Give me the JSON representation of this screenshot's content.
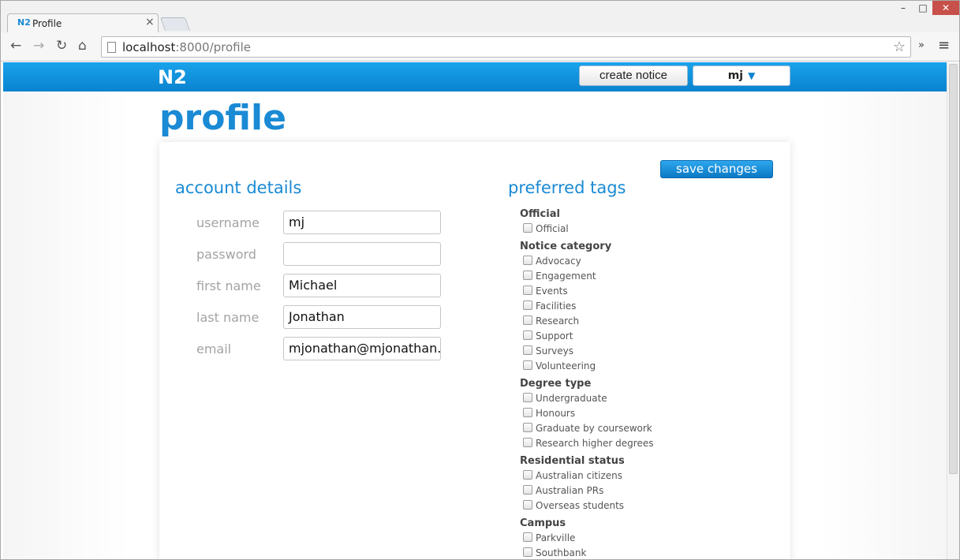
{
  "browser": {
    "tab_favicon": "N2",
    "tab_title": "Profile",
    "tab_close": "×",
    "url_host": "localhost",
    "url_path": ":8000/profile",
    "icons": [
      "back-arrow-icon",
      "forward-arrow-icon",
      "reload-icon",
      "home-icon",
      "bookmark-star-icon",
      "menu-icon"
    ]
  },
  "header": {
    "brand": "N2",
    "create_notice": "create notice",
    "user": "mj",
    "user_caret": "▼",
    "brand_color": "#0a82cf"
  },
  "page": {
    "title": "profile",
    "save_label": "save changes"
  },
  "account": {
    "title": "account details",
    "fields": [
      {
        "label": "username",
        "value": "mj"
      },
      {
        "label": "password",
        "value": ""
      },
      {
        "label": "first name",
        "value": "Michael"
      },
      {
        "label": "last name",
        "value": "Jonathan"
      },
      {
        "label": "email",
        "value": "mjonathan@mjonathan."
      }
    ]
  },
  "tags": {
    "title": "preferred tags",
    "groups": [
      {
        "name": "Official",
        "items": [
          "Official"
        ]
      },
      {
        "name": "Notice category",
        "items": [
          "Advocacy",
          "Engagement",
          "Events",
          "Facilities",
          "Research",
          "Support",
          "Surveys",
          "Volunteering"
        ]
      },
      {
        "name": "Degree type",
        "items": [
          "Undergraduate",
          "Honours",
          "Graduate by coursework",
          "Research higher degrees"
        ]
      },
      {
        "name": "Residential status",
        "items": [
          "Australian citizens",
          "Australian PRs",
          "Overseas students"
        ]
      },
      {
        "name": "Campus",
        "items": [
          "Parkville",
          "Southbank"
        ]
      }
    ]
  }
}
